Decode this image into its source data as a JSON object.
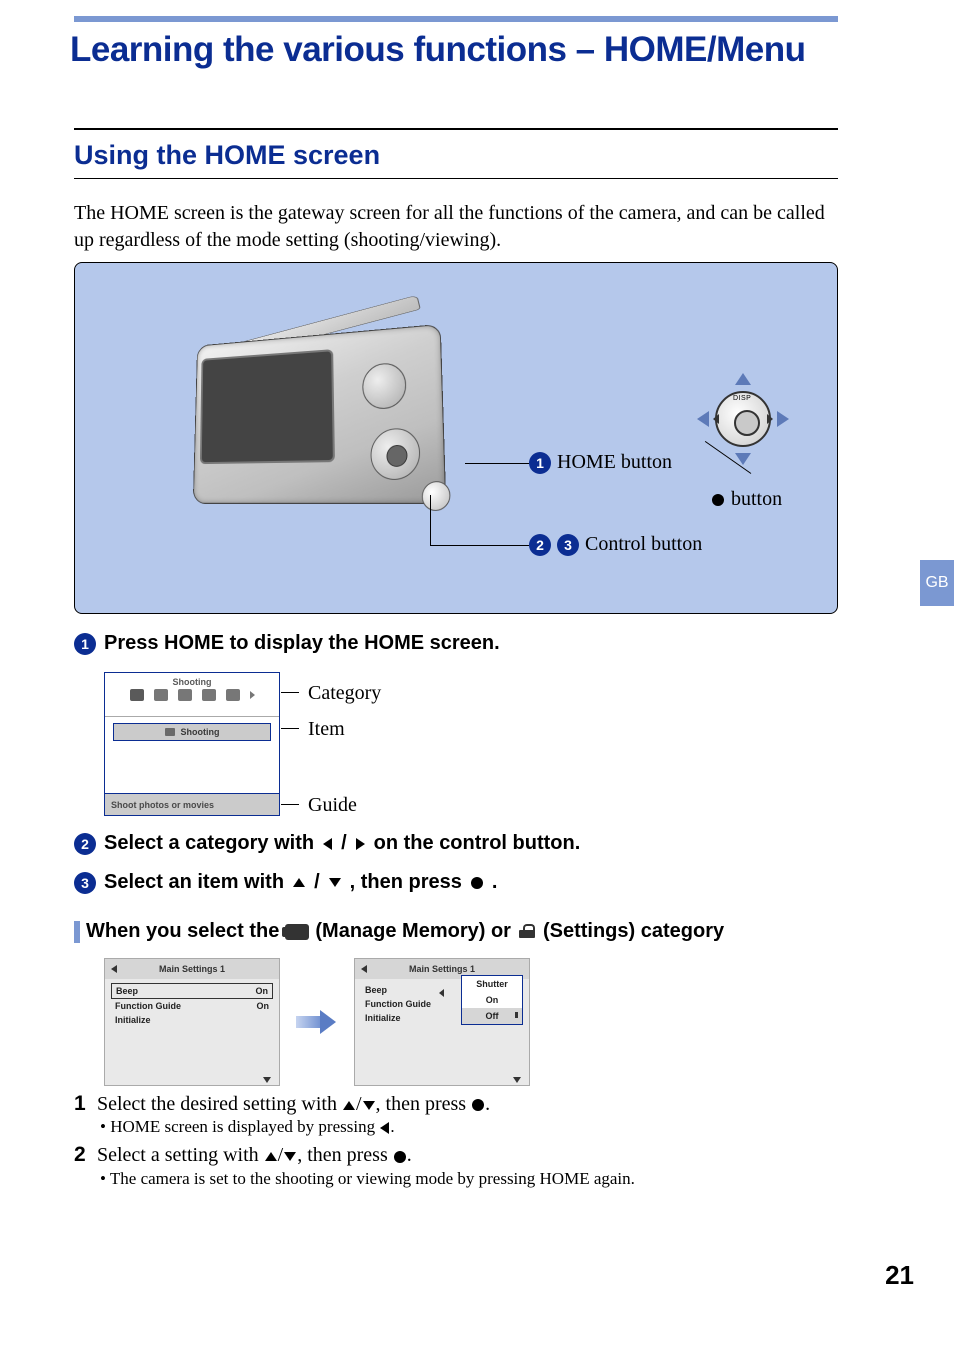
{
  "page": {
    "chapter_title": "Learning the various functions – HOME/Menu",
    "section_title": "Using the HOME screen",
    "intro": "The HOME screen is the gateway screen for all the functions of the camera, and can be called up regardless of the mode setting (shooting/viewing).",
    "side_tab": "GB",
    "page_number": "21"
  },
  "diagram": {
    "callouts": {
      "home_button": "HOME button",
      "dot_button": "button",
      "control_button": "Control button",
      "disp": "DISP"
    }
  },
  "steps": {
    "s1": "Press HOME to display the HOME screen.",
    "s2": "Select a category with ◀/▶ on the control button.",
    "s2_pre": " Select a category with ",
    "s2_post": " on the control button.",
    "s3_pre": " Select an item with ",
    "s3_mid": ", then press ",
    "s3_post": "."
  },
  "home_screen": {
    "top_label": "Shooting",
    "item_label": "Shooting",
    "guide_text": "Shoot photos or movies",
    "callouts": {
      "category": "Category",
      "item": "Item",
      "guide": "Guide"
    }
  },
  "subsection": {
    "pre": "When you select the ",
    "mem": " (Manage Memory) or ",
    "set": " (Settings) category"
  },
  "settings_screens": {
    "title": "Main Settings 1",
    "rows": {
      "beep": {
        "label": "Beep",
        "value": "On"
      },
      "guide": {
        "label": "Function Guide",
        "value": "On"
      },
      "init": {
        "label": "Initialize",
        "value": ""
      }
    },
    "popup": {
      "opt1": "Shutter",
      "opt2": "On",
      "opt3": "Off"
    }
  },
  "numbered_list": {
    "i1_pre": "Select the desired setting with ",
    "i1_mid": ", then press ",
    "i1_post": ".",
    "i1_sub_pre": "• HOME screen is displayed by pressing ",
    "i1_sub_post": ".",
    "i2_pre": "Select a setting with ",
    "i2_mid": ", then press ",
    "i2_post": ".",
    "i2_sub": "• The camera is set to the shooting or viewing mode by pressing HOME again."
  }
}
